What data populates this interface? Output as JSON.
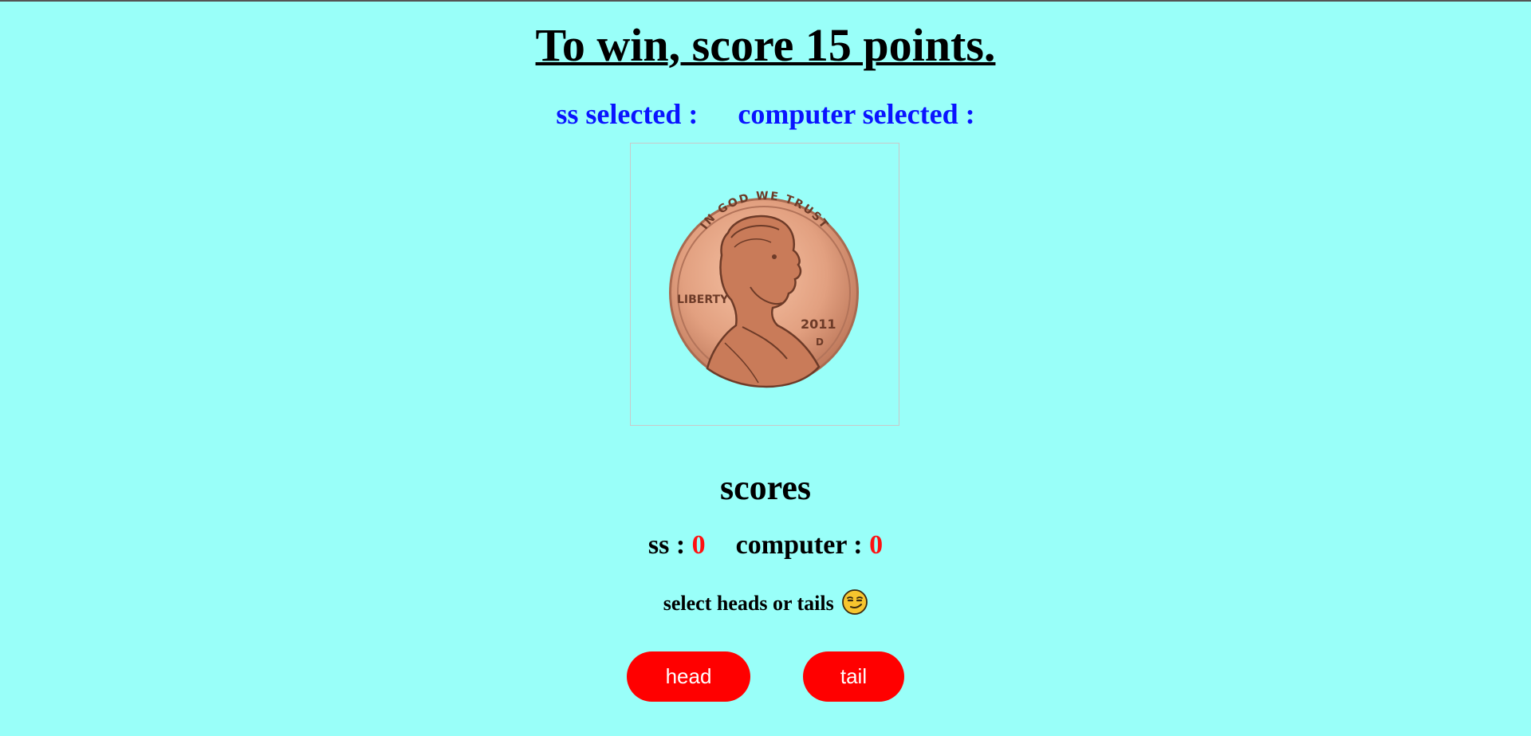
{
  "title": "To win, score 15 points.",
  "selection": {
    "player_label": "ss selected :",
    "player_value": "",
    "computer_label": "computer selected :",
    "computer_value": ""
  },
  "coin": {
    "motto": "IN GOD WE TRUST",
    "legend": "LIBERTY",
    "year": "2011",
    "mint_mark": "D",
    "icon": "penny-coin-image"
  },
  "scores": {
    "heading": "scores",
    "player_label": "ss :",
    "player_score": "0",
    "computer_label": "computer :",
    "computer_score": "0"
  },
  "prompt": {
    "text": "select heads or tails",
    "icon": "smirking-face-emoji"
  },
  "buttons": {
    "head_label": "head",
    "tail_label": "tail"
  },
  "colors": {
    "background": "#99fff9",
    "selection_text": "#0a14ff",
    "score_value": "#ff1010",
    "button": "#ff0000"
  }
}
